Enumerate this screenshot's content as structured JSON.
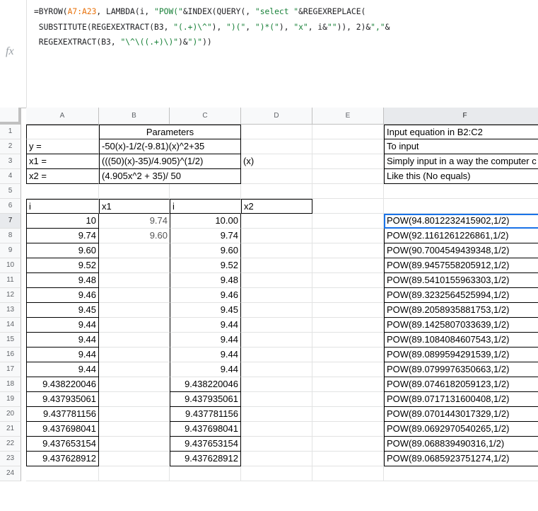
{
  "formula_bar": {
    "fx_label": "fx",
    "lines": [
      [
        {
          "t": "=BYROW(",
          "k": "n"
        },
        {
          "t": "A7:A23",
          "k": "ref"
        },
        {
          "t": ", LAMBDA(i, ",
          "k": "n"
        },
        {
          "t": "\"POW(\"",
          "k": "str"
        },
        {
          "t": "&INDEX(QUERY(, ",
          "k": "n"
        },
        {
          "t": "\"select \"",
          "k": "str"
        },
        {
          "t": "&REGEXREPLACE(",
          "k": "n"
        }
      ],
      [
        {
          "t": " SUBSTITUTE(REGEXEXTRACT(B3, ",
          "k": "n"
        },
        {
          "t": "\"(.+)\\^\"",
          "k": "str"
        },
        {
          "t": "), ",
          "k": "n"
        },
        {
          "t": "\")(\"",
          "k": "str"
        },
        {
          "t": ", ",
          "k": "n"
        },
        {
          "t": "\")*(\"",
          "k": "str"
        },
        {
          "t": "), ",
          "k": "n"
        },
        {
          "t": "\"x\"",
          "k": "str"
        },
        {
          "t": ", i&",
          "k": "n"
        },
        {
          "t": "\"\"",
          "k": "str"
        },
        {
          "t": ")), 2)&",
          "k": "n"
        },
        {
          "t": "\",\"",
          "k": "str"
        },
        {
          "t": "&",
          "k": "n"
        }
      ],
      [
        {
          "t": " REGEXEXTRACT(B3, ",
          "k": "n"
        },
        {
          "t": "\"\\^\\((.+)\\)\"",
          "k": "str"
        },
        {
          "t": ")&",
          "k": "n"
        },
        {
          "t": "\")\"",
          "k": "str"
        },
        {
          "t": "))",
          "k": "n"
        }
      ]
    ]
  },
  "columns": [
    "A",
    "B",
    "C",
    "D",
    "E",
    "F"
  ],
  "selected_column": "F",
  "selected_row": "7",
  "rows": [
    "1",
    "2",
    "3",
    "4",
    "5",
    "6",
    "7",
    "8",
    "9",
    "10",
    "11",
    "12",
    "13",
    "14",
    "15",
    "16",
    "17",
    "18",
    "19",
    "20",
    "21",
    "22",
    "23",
    "24"
  ],
  "cells": {
    "B1": "Parameters",
    "A2": "y =",
    "B2": "-50(x)-1/2(-9.81)(x)^2+35",
    "A3": "x1 =",
    "B3": "(((50)(x)-35)/4.905)^(1/2)",
    "D3": "(x)",
    "A4": "x2 =",
    "B4": "(4.905x^2 + 35)/ 50",
    "A6": "i",
    "B6": "x1",
    "C6": "i",
    "D6": "x2",
    "F1": "Input equation in B2:C2",
    "F2": "To input",
    "F3": "Simply input in a way the computer c",
    "F4": "Like this (No equals)"
  },
  "table": {
    "A": [
      "10",
      "9.74",
      "9.60",
      "9.52",
      "9.48",
      "9.46",
      "9.45",
      "9.44",
      "9.44",
      "9.44",
      "9.44",
      "9.438220046",
      "9.437935061",
      "9.437781156",
      "9.437698041",
      "9.437653154",
      "9.437628912"
    ],
    "B": [
      "9.74",
      "9.60",
      "",
      "",
      "",
      "",
      "",
      "",
      "",
      "",
      "",
      "",
      "",
      "",
      "",
      "",
      ""
    ],
    "C": [
      "10.00",
      "9.74",
      "9.60",
      "9.52",
      "9.48",
      "9.46",
      "9.45",
      "9.44",
      "9.44",
      "9.44",
      "9.44",
      "9.438220046",
      "9.437935061",
      "9.437781156",
      "9.437698041",
      "9.437653154",
      "9.437628912"
    ],
    "F": [
      "POW(94.8012232415902,1/2)",
      "POW(92.1161261226861,1/2)",
      "POW(90.7004549439348,1/2)",
      "POW(89.9457558205912,1/2)",
      "POW(89.5410155963303,1/2)",
      "POW(89.3232564525994,1/2)",
      "POW(89.2058935881753,1/2)",
      "POW(89.1425807033639,1/2)",
      "POW(89.1084084607543,1/2)",
      "POW(89.0899594291539,1/2)",
      "POW(89.0799976350663,1/2)",
      "POW(89.0746182059123,1/2)",
      "POW(89.0717131600408,1/2)",
      "POW(89.0701443017329,1/2)",
      "POW(89.0692970540265,1/2)",
      "POW(89.068839490316,1/2)",
      "POW(89.0685923751274,1/2)"
    ]
  }
}
